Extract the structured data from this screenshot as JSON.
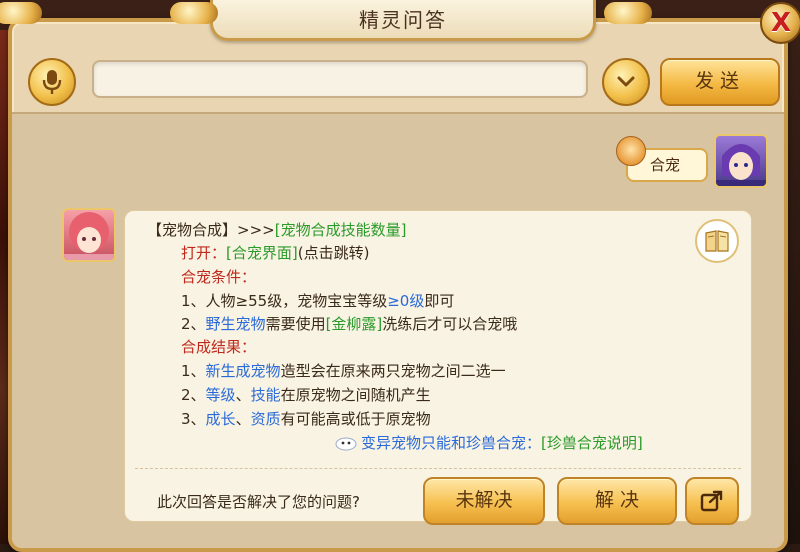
{
  "window": {
    "title": "精灵问答",
    "close_label": "X"
  },
  "topbar": {
    "mic_icon": "microphone-icon",
    "search_value": "",
    "search_placeholder": "",
    "dropdown_icon": "chevron-down-icon",
    "send_label": "发送"
  },
  "chat": {
    "user_message": "合宠",
    "answer": {
      "header_prefix": "【宠物合成】>>>",
      "header_link": "[宠物合成技能数量]",
      "open_label": "打开：",
      "open_link": "[合宠界面]",
      "open_suffix": "(点击跳转)",
      "cond_title": "合宠条件：",
      "cond1_a": "1、人物≥55级，宠物宝宝等级",
      "cond1_b": "≥0级",
      "cond1_c": "即可",
      "cond2_a": "2、",
      "cond2_b": "野生宠物",
      "cond2_c": "需要使用",
      "cond2_d": "[金柳露]",
      "cond2_e": "洗练后才可以合宠哦",
      "result_title": "合成结果：",
      "res1_a": "1、",
      "res1_b": "新生成宠物",
      "res1_c": "造型会在原来两只宠物之间二选一",
      "res2_a": "2、",
      "res2_b": "等级",
      "res2_sep": "、",
      "res2_c": "技能",
      "res2_d": "在原宠物之间随机产生",
      "res3_a": "3、",
      "res3_b": "成长",
      "res3_sep": "、",
      "res3_c": "资质",
      "res3_d": "有可能高或低于原宠物",
      "mutant_text": "变异宠物只能和珍兽合宠：",
      "mutant_link": "[珍兽合宠说明]",
      "question": "此次回答是否解决了您的问题?",
      "unresolved_label": "未解决",
      "resolved_label": "解 决"
    }
  },
  "colors": {
    "red": "#c0281c",
    "green": "#2a9a2a",
    "blue": "#2a6ad8",
    "gold": "#f4b944"
  }
}
